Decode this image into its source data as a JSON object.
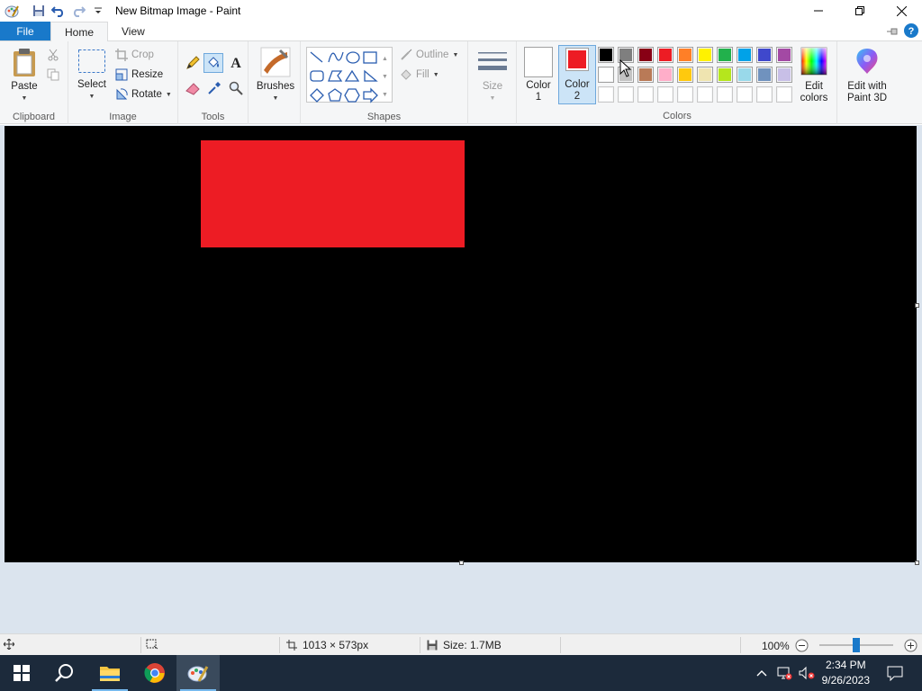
{
  "window": {
    "title": "New Bitmap Image - Paint"
  },
  "tabs": {
    "file": "File",
    "home": "Home",
    "view": "View"
  },
  "clipboard": {
    "paste": "Paste",
    "group": "Clipboard"
  },
  "image": {
    "select": "Select",
    "crop": "Crop",
    "resize": "Resize",
    "rotate": "Rotate",
    "group": "Image"
  },
  "tools": {
    "group": "Tools"
  },
  "brushes": {
    "label": "Brushes"
  },
  "shapes": {
    "outline": "Outline",
    "fill": "Fill",
    "group": "Shapes"
  },
  "size": {
    "label": "Size"
  },
  "colors": {
    "color1_line1": "Color",
    "color1_line2": "1",
    "color2_line1": "Color",
    "color2_line2": "2",
    "color1_value": "#ffffff",
    "color2_value": "#ed1c24",
    "edit_line1": "Edit",
    "edit_line2": "colors",
    "paint3d_line1": "Edit with",
    "paint3d_line2": "Paint 3D",
    "group": "Colors",
    "palette_row1": [
      "#000000",
      "#7f7f7f",
      "#880015",
      "#ed1c24",
      "#ff7f27",
      "#fff200",
      "#22b14c",
      "#00a2e8",
      "#3f48cc",
      "#a349a4"
    ],
    "palette_row2": [
      "#ffffff",
      "#c3c3c3",
      "#b97a57",
      "#ffaec9",
      "#ffc90e",
      "#efe4b0",
      "#b5e61d",
      "#99d9ea",
      "#7092be",
      "#c8bfe7"
    ],
    "palette_row3": [
      "#ffffff",
      "#ffffff",
      "#ffffff",
      "#ffffff",
      "#ffffff",
      "#ffffff",
      "#ffffff",
      "#ffffff",
      "#ffffff",
      "#ffffff"
    ]
  },
  "canvas": {
    "background": "#000000",
    "shape_color": "#ed1c24"
  },
  "status": {
    "dimensions": "1013 × 573px",
    "size": "Size: 1.7MB",
    "zoom": "100%",
    "zoom_fraction": 0.5
  },
  "taskbar": {
    "time": "2:34 PM",
    "date": "9/26/2023"
  }
}
